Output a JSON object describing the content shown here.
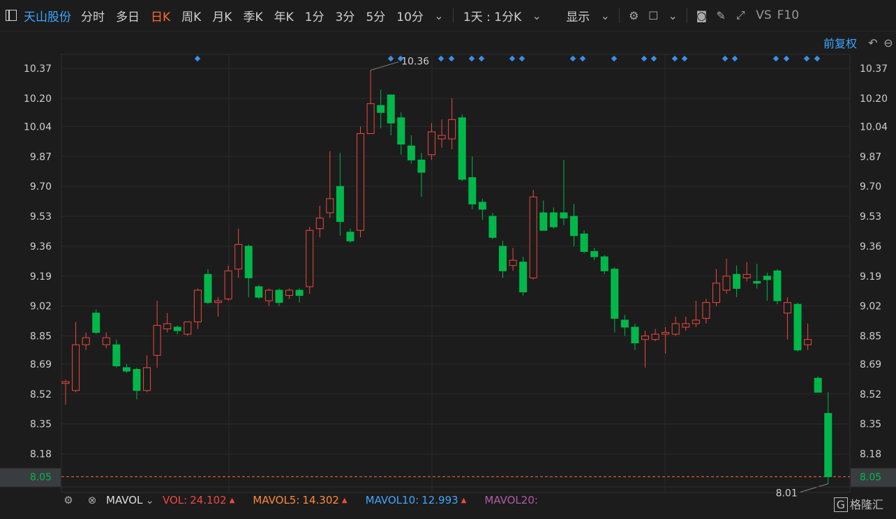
{
  "toolbar": {
    "stock_name": "天山股份",
    "periods": [
      "分时",
      "多日",
      "日K",
      "周K",
      "月K",
      "季K",
      "年K",
      "1分",
      "3分",
      "5分",
      "10分"
    ],
    "active_period": "日K",
    "interval_label": "1天 : 1分K",
    "display_label": "显示",
    "vs_label": "VS",
    "f10_label": "F10"
  },
  "subbar": {
    "adjust_label": "前复权"
  },
  "volume_panel": {
    "indicator": "MAVOL",
    "vol_label": "VOL:",
    "vol_value": "24.102",
    "mavol5_label": "MAVOL5:",
    "mavol5_value": "14.302",
    "mavol10_label": "MAVOL10:",
    "mavol10_value": "12.993",
    "mavol20_label": "MAVOL20:"
  },
  "watermark": "格隆汇",
  "colors": {
    "up": "#f0483e",
    "down": "#00b84a",
    "dashed": "#ff6a2b",
    "dot": "#3a8fe8",
    "name": "#3ea6ff"
  },
  "chart_data": {
    "type": "candlestick",
    "ylim": [
      8.0,
      10.45
    ],
    "y_ticks": [
      "10.37",
      "10.20",
      "10.04",
      "9.87",
      "9.70",
      "9.53",
      "9.36",
      "9.19",
      "9.02",
      "8.85",
      "8.69",
      "8.52",
      "8.35",
      "8.18",
      "8.05"
    ],
    "last_price": "8.05",
    "high_label": "10.36",
    "low_label": "8.01",
    "candles": [
      {
        "o": 8.58,
        "c": 8.59,
        "h": 8.6,
        "l": 8.46
      },
      {
        "o": 8.54,
        "c": 8.8,
        "h": 8.93,
        "l": 8.53
      },
      {
        "o": 8.8,
        "c": 8.84,
        "h": 8.87,
        "l": 8.77
      },
      {
        "o": 8.98,
        "c": 8.87,
        "h": 9.0,
        "l": 8.86
      },
      {
        "o": 8.8,
        "c": 8.84,
        "h": 8.87,
        "l": 8.78
      },
      {
        "o": 8.8,
        "c": 8.68,
        "h": 8.83,
        "l": 8.67
      },
      {
        "o": 8.67,
        "c": 8.65,
        "h": 8.69,
        "l": 8.64
      },
      {
        "o": 8.66,
        "c": 8.54,
        "h": 8.67,
        "l": 8.49
      },
      {
        "o": 8.54,
        "c": 8.67,
        "h": 8.74,
        "l": 8.53
      },
      {
        "o": 8.74,
        "c": 8.91,
        "h": 9.05,
        "l": 8.67
      },
      {
        "o": 8.89,
        "c": 8.92,
        "h": 8.98,
        "l": 8.87
      },
      {
        "o": 8.9,
        "c": 8.88,
        "h": 8.91,
        "l": 8.86
      },
      {
        "o": 8.86,
        "c": 8.93,
        "h": 8.93,
        "l": 8.85
      },
      {
        "o": 8.93,
        "c": 9.11,
        "h": 9.12,
        "l": 8.89
      },
      {
        "o": 9.2,
        "c": 9.04,
        "h": 9.23,
        "l": 9.03
      },
      {
        "o": 9.04,
        "c": 9.05,
        "h": 9.07,
        "l": 8.96
      },
      {
        "o": 9.06,
        "c": 9.22,
        "h": 9.25,
        "l": 9.05
      },
      {
        "o": 9.23,
        "c": 9.37,
        "h": 9.46,
        "l": 9.18
      },
      {
        "o": 9.36,
        "c": 9.18,
        "h": 9.37,
        "l": 9.07
      },
      {
        "o": 9.13,
        "c": 9.07,
        "h": 9.14,
        "l": 9.06
      },
      {
        "o": 9.05,
        "c": 9.11,
        "h": 9.12,
        "l": 9.02
      },
      {
        "o": 9.11,
        "c": 9.04,
        "h": 9.12,
        "l": 9.02
      },
      {
        "o": 9.08,
        "c": 9.11,
        "h": 9.12,
        "l": 9.06
      },
      {
        "o": 9.11,
        "c": 9.08,
        "h": 9.12,
        "l": 9.04
      },
      {
        "o": 9.13,
        "c": 9.45,
        "h": 9.47,
        "l": 9.09
      },
      {
        "o": 9.46,
        "c": 9.52,
        "h": 9.59,
        "l": 9.41
      },
      {
        "o": 9.55,
        "c": 9.63,
        "h": 9.9,
        "l": 9.52
      },
      {
        "o": 9.7,
        "c": 9.5,
        "h": 9.89,
        "l": 9.42
      },
      {
        "o": 9.44,
        "c": 9.39,
        "h": 9.46,
        "l": 9.38
      },
      {
        "o": 9.45,
        "c": 10.0,
        "h": 10.04,
        "l": 9.41
      },
      {
        "o": 10.0,
        "c": 10.17,
        "h": 10.36,
        "l": 10.0
      },
      {
        "o": 10.16,
        "c": 10.12,
        "h": 10.25,
        "l": 10.03
      },
      {
        "o": 10.22,
        "c": 10.06,
        "h": 10.22,
        "l": 9.99
      },
      {
        "o": 10.09,
        "c": 9.94,
        "h": 10.12,
        "l": 9.88
      },
      {
        "o": 9.93,
        "c": 9.85,
        "h": 9.99,
        "l": 9.83
      },
      {
        "o": 9.85,
        "c": 9.78,
        "h": 9.89,
        "l": 9.64
      },
      {
        "o": 9.88,
        "c": 10.01,
        "h": 10.06,
        "l": 9.85
      },
      {
        "o": 9.97,
        "c": 9.99,
        "h": 10.08,
        "l": 9.92
      },
      {
        "o": 9.97,
        "c": 10.08,
        "h": 10.2,
        "l": 9.91
      },
      {
        "o": 10.09,
        "c": 9.74,
        "h": 10.11,
        "l": 9.73
      },
      {
        "o": 9.75,
        "c": 9.6,
        "h": 9.87,
        "l": 9.57
      },
      {
        "o": 9.61,
        "c": 9.57,
        "h": 9.63,
        "l": 9.51
      },
      {
        "o": 9.53,
        "c": 9.41,
        "h": 9.55,
        "l": 9.4
      },
      {
        "o": 9.36,
        "c": 9.22,
        "h": 9.39,
        "l": 9.18
      },
      {
        "o": 9.25,
        "c": 9.28,
        "h": 9.35,
        "l": 9.22
      },
      {
        "o": 9.27,
        "c": 9.1,
        "h": 9.3,
        "l": 9.08
      },
      {
        "o": 9.18,
        "c": 9.64,
        "h": 9.68,
        "l": 9.17
      },
      {
        "o": 9.55,
        "c": 9.45,
        "h": 9.62,
        "l": 9.45
      },
      {
        "o": 9.55,
        "c": 9.47,
        "h": 9.58,
        "l": 9.46
      },
      {
        "o": 9.55,
        "c": 9.52,
        "h": 9.85,
        "l": 9.48
      },
      {
        "o": 9.53,
        "c": 9.42,
        "h": 9.6,
        "l": 9.36
      },
      {
        "o": 9.43,
        "c": 9.33,
        "h": 9.45,
        "l": 9.32
      },
      {
        "o": 9.33,
        "c": 9.3,
        "h": 9.35,
        "l": 9.28
      },
      {
        "o": 9.3,
        "c": 9.22,
        "h": 9.31,
        "l": 9.2
      },
      {
        "o": 9.23,
        "c": 8.95,
        "h": 9.24,
        "l": 8.87
      },
      {
        "o": 8.94,
        "c": 8.9,
        "h": 8.97,
        "l": 8.85
      },
      {
        "o": 8.9,
        "c": 8.81,
        "h": 8.92,
        "l": 8.77
      },
      {
        "o": 8.83,
        "c": 8.85,
        "h": 8.88,
        "l": 8.67
      },
      {
        "o": 8.83,
        "c": 8.86,
        "h": 8.89,
        "l": 8.82
      },
      {
        "o": 8.86,
        "c": 8.87,
        "h": 8.9,
        "l": 8.75
      },
      {
        "o": 8.86,
        "c": 8.92,
        "h": 8.96,
        "l": 8.85
      },
      {
        "o": 8.9,
        "c": 8.92,
        "h": 8.96,
        "l": 8.88
      },
      {
        "o": 8.92,
        "c": 8.94,
        "h": 9.05,
        "l": 8.9
      },
      {
        "o": 8.95,
        "c": 9.04,
        "h": 9.06,
        "l": 8.92
      },
      {
        "o": 9.04,
        "c": 9.15,
        "h": 9.23,
        "l": 9.02
      },
      {
        "o": 9.11,
        "c": 9.19,
        "h": 9.29,
        "l": 9.09
      },
      {
        "o": 9.2,
        "c": 9.12,
        "h": 9.25,
        "l": 9.07
      },
      {
        "o": 9.18,
        "c": 9.2,
        "h": 9.27,
        "l": 9.16
      },
      {
        "o": 9.16,
        "c": 9.15,
        "h": 9.26,
        "l": 9.12
      },
      {
        "o": 9.19,
        "c": 9.17,
        "h": 9.21,
        "l": 9.05
      },
      {
        "o": 9.22,
        "c": 9.05,
        "h": 9.23,
        "l": 9.03
      },
      {
        "o": 8.98,
        "c": 9.04,
        "h": 9.07,
        "l": 8.83
      },
      {
        "o": 9.03,
        "c": 8.77,
        "h": 9.04,
        "l": 8.76
      },
      {
        "o": 8.8,
        "c": 8.83,
        "h": 8.92,
        "l": 8.77
      },
      {
        "o": 8.61,
        "c": 8.53,
        "h": 8.62,
        "l": 8.53
      },
      {
        "o": 8.41,
        "c": 8.05,
        "h": 8.53,
        "l": 8.01
      }
    ]
  }
}
